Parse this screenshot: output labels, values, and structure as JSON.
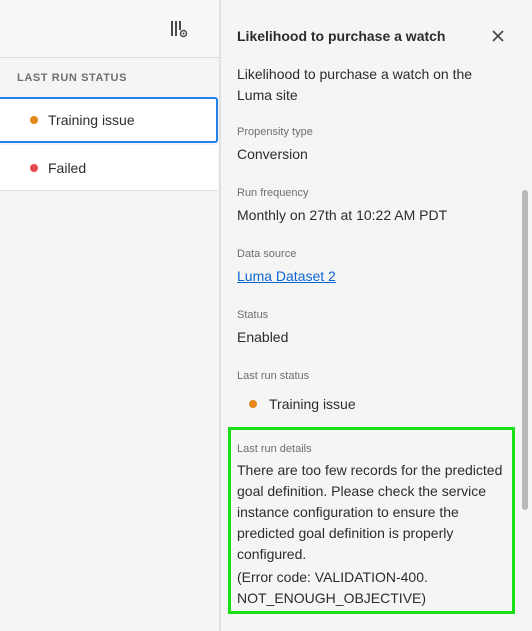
{
  "left_panel": {
    "column_header": "LAST RUN STATUS",
    "rows": [
      {
        "label": "Training issue",
        "dot_color": "#e68619",
        "selected": true
      },
      {
        "label": "Failed",
        "dot_color": "#e34850",
        "selected": false
      }
    ],
    "column_settings_icon": "column-settings-icon"
  },
  "detail_panel": {
    "title": "Likelihood to purchase a watch",
    "close_icon": "close-icon",
    "description": "Likelihood to purchase a watch on the Luma site",
    "propensity_type": {
      "label": "Propensity type",
      "value": "Conversion"
    },
    "run_frequency": {
      "label": "Run frequency",
      "value": "Monthly on 27th at 10:22 AM PDT"
    },
    "data_source": {
      "label": "Data source",
      "value": "Luma Dataset 2"
    },
    "status": {
      "label": "Status",
      "value": "Enabled"
    },
    "last_run_status": {
      "label": "Last run status",
      "value": "Training issue",
      "dot_color": "#e68619"
    },
    "last_run_details": {
      "label": "Last run details",
      "message": "There are too few records for the predicted goal definition. Please check the service instance configuration to ensure the predicted goal definition is properly configured.",
      "error_line1": "(Error code: VALIDATION-400.",
      "error_line2": "NOT_ENOUGH_OBJECTIVE)"
    }
  },
  "colors": {
    "selected_border": "#2680eb",
    "highlight_border": "#1ae01a",
    "link": "#0d66d0"
  }
}
